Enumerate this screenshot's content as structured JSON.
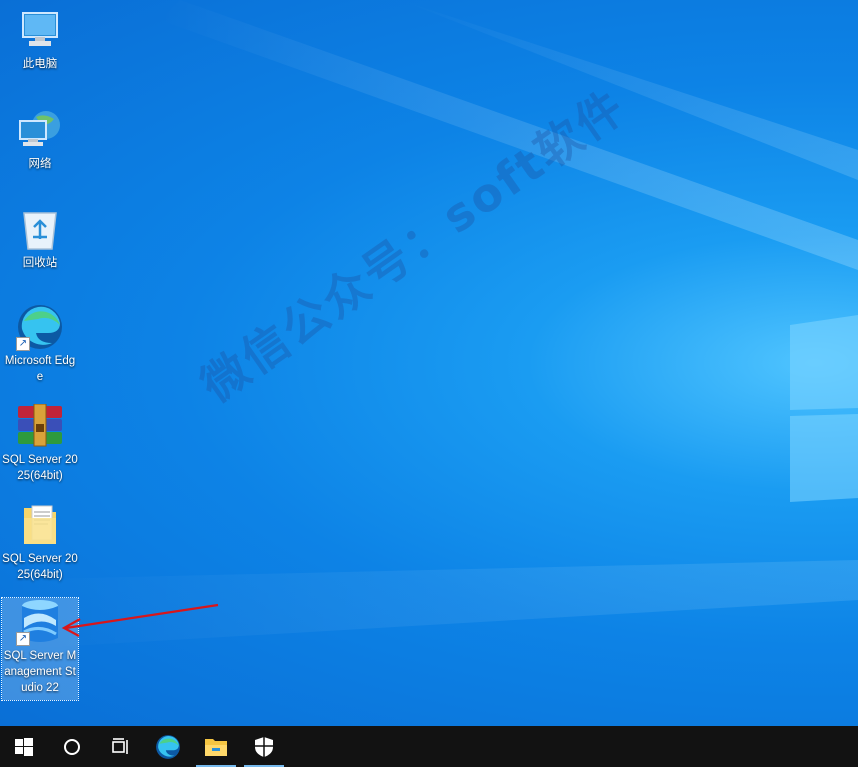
{
  "desktop": {
    "watermark": "微信公众号：soft软件",
    "icons": [
      {
        "label": "此电脑",
        "glyph": "computer-icon"
      },
      {
        "label": "网络",
        "glyph": "network-icon"
      },
      {
        "label": "回收站",
        "glyph": "recycle-bin-icon"
      },
      {
        "label": "Microsoft Edge",
        "glyph": "edge-icon"
      },
      {
        "label": "SQL Server 2025(64bit)",
        "glyph": "winrar-archive-icon"
      },
      {
        "label": "SQL Server 2025(64bit)",
        "glyph": "folder-icon"
      },
      {
        "label": "SQL Server Management Studio 22",
        "glyph": "ssms-icon",
        "selected": true
      }
    ]
  },
  "taskbar": {
    "items": [
      "start-icon",
      "search-icon",
      "task-view-icon",
      "edge-icon",
      "file-explorer-icon",
      "security-icon"
    ],
    "active": [
      "file-explorer-icon",
      "security-icon"
    ]
  },
  "colors": {
    "desktop_blue": "#0d83e6",
    "taskbar": "#121212",
    "arrow": "#d8161b"
  }
}
